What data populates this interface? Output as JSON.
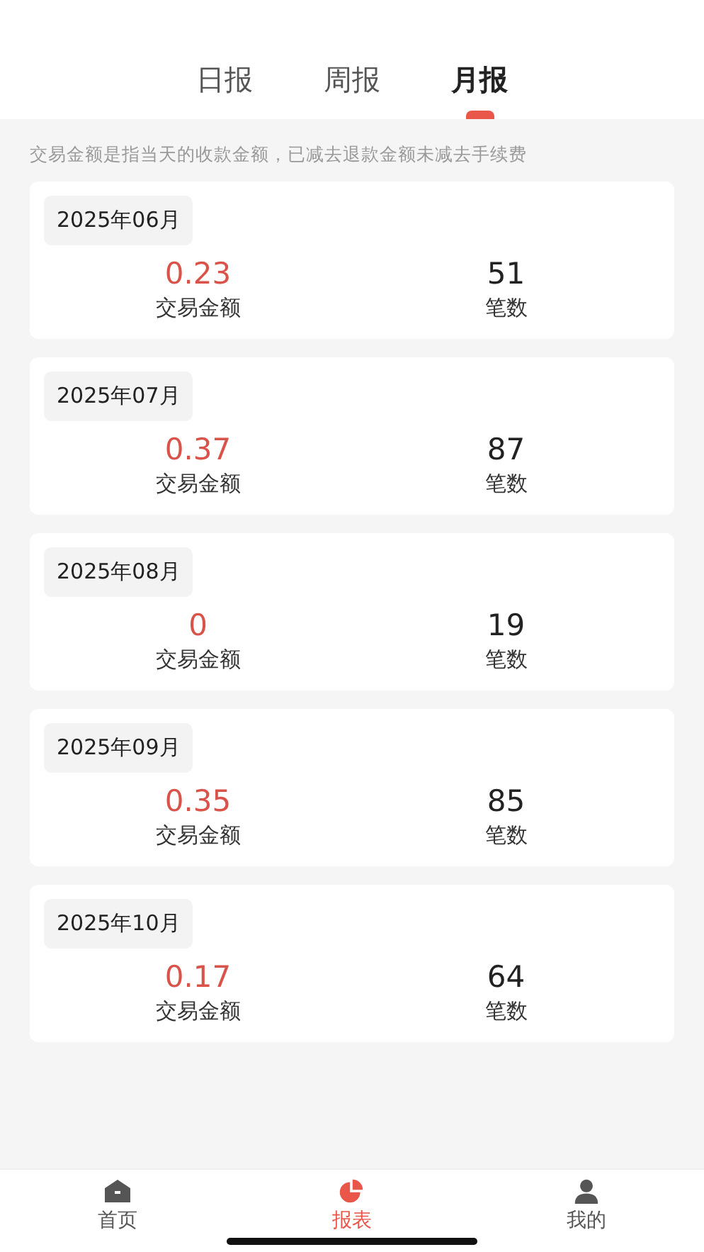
{
  "tabs": [
    {
      "label": "日报",
      "selected": false
    },
    {
      "label": "周报",
      "selected": false
    },
    {
      "label": "月报",
      "selected": true
    }
  ],
  "note": "交易金额是指当天的收款金额，已减去退款金额未减去手续费",
  "months": [
    {
      "month": "2025年06月",
      "amount": "0.23",
      "amount_label": "交易金额",
      "count": "51",
      "count_label": "笔数"
    },
    {
      "month": "2025年07月",
      "amount": "0.37",
      "amount_label": "交易金额",
      "count": "87",
      "count_label": "笔数"
    },
    {
      "month": "2025年08月",
      "amount": "0",
      "amount_label": "交易金额",
      "count": "19",
      "count_label": "笔数"
    },
    {
      "month": "2025年09月",
      "amount": "0.35",
      "amount_label": "交易金额",
      "count": "85",
      "count_label": "笔数"
    },
    {
      "month": "2025年10月",
      "amount": "0.17",
      "amount_label": "交易金额",
      "count": "64",
      "count_label": "笔数"
    }
  ],
  "nav": [
    {
      "label": "首页",
      "kind": "home",
      "selected": false
    },
    {
      "label": "报表",
      "kind": "report",
      "selected": true
    },
    {
      "label": "我的",
      "kind": "profile",
      "selected": false
    }
  ]
}
